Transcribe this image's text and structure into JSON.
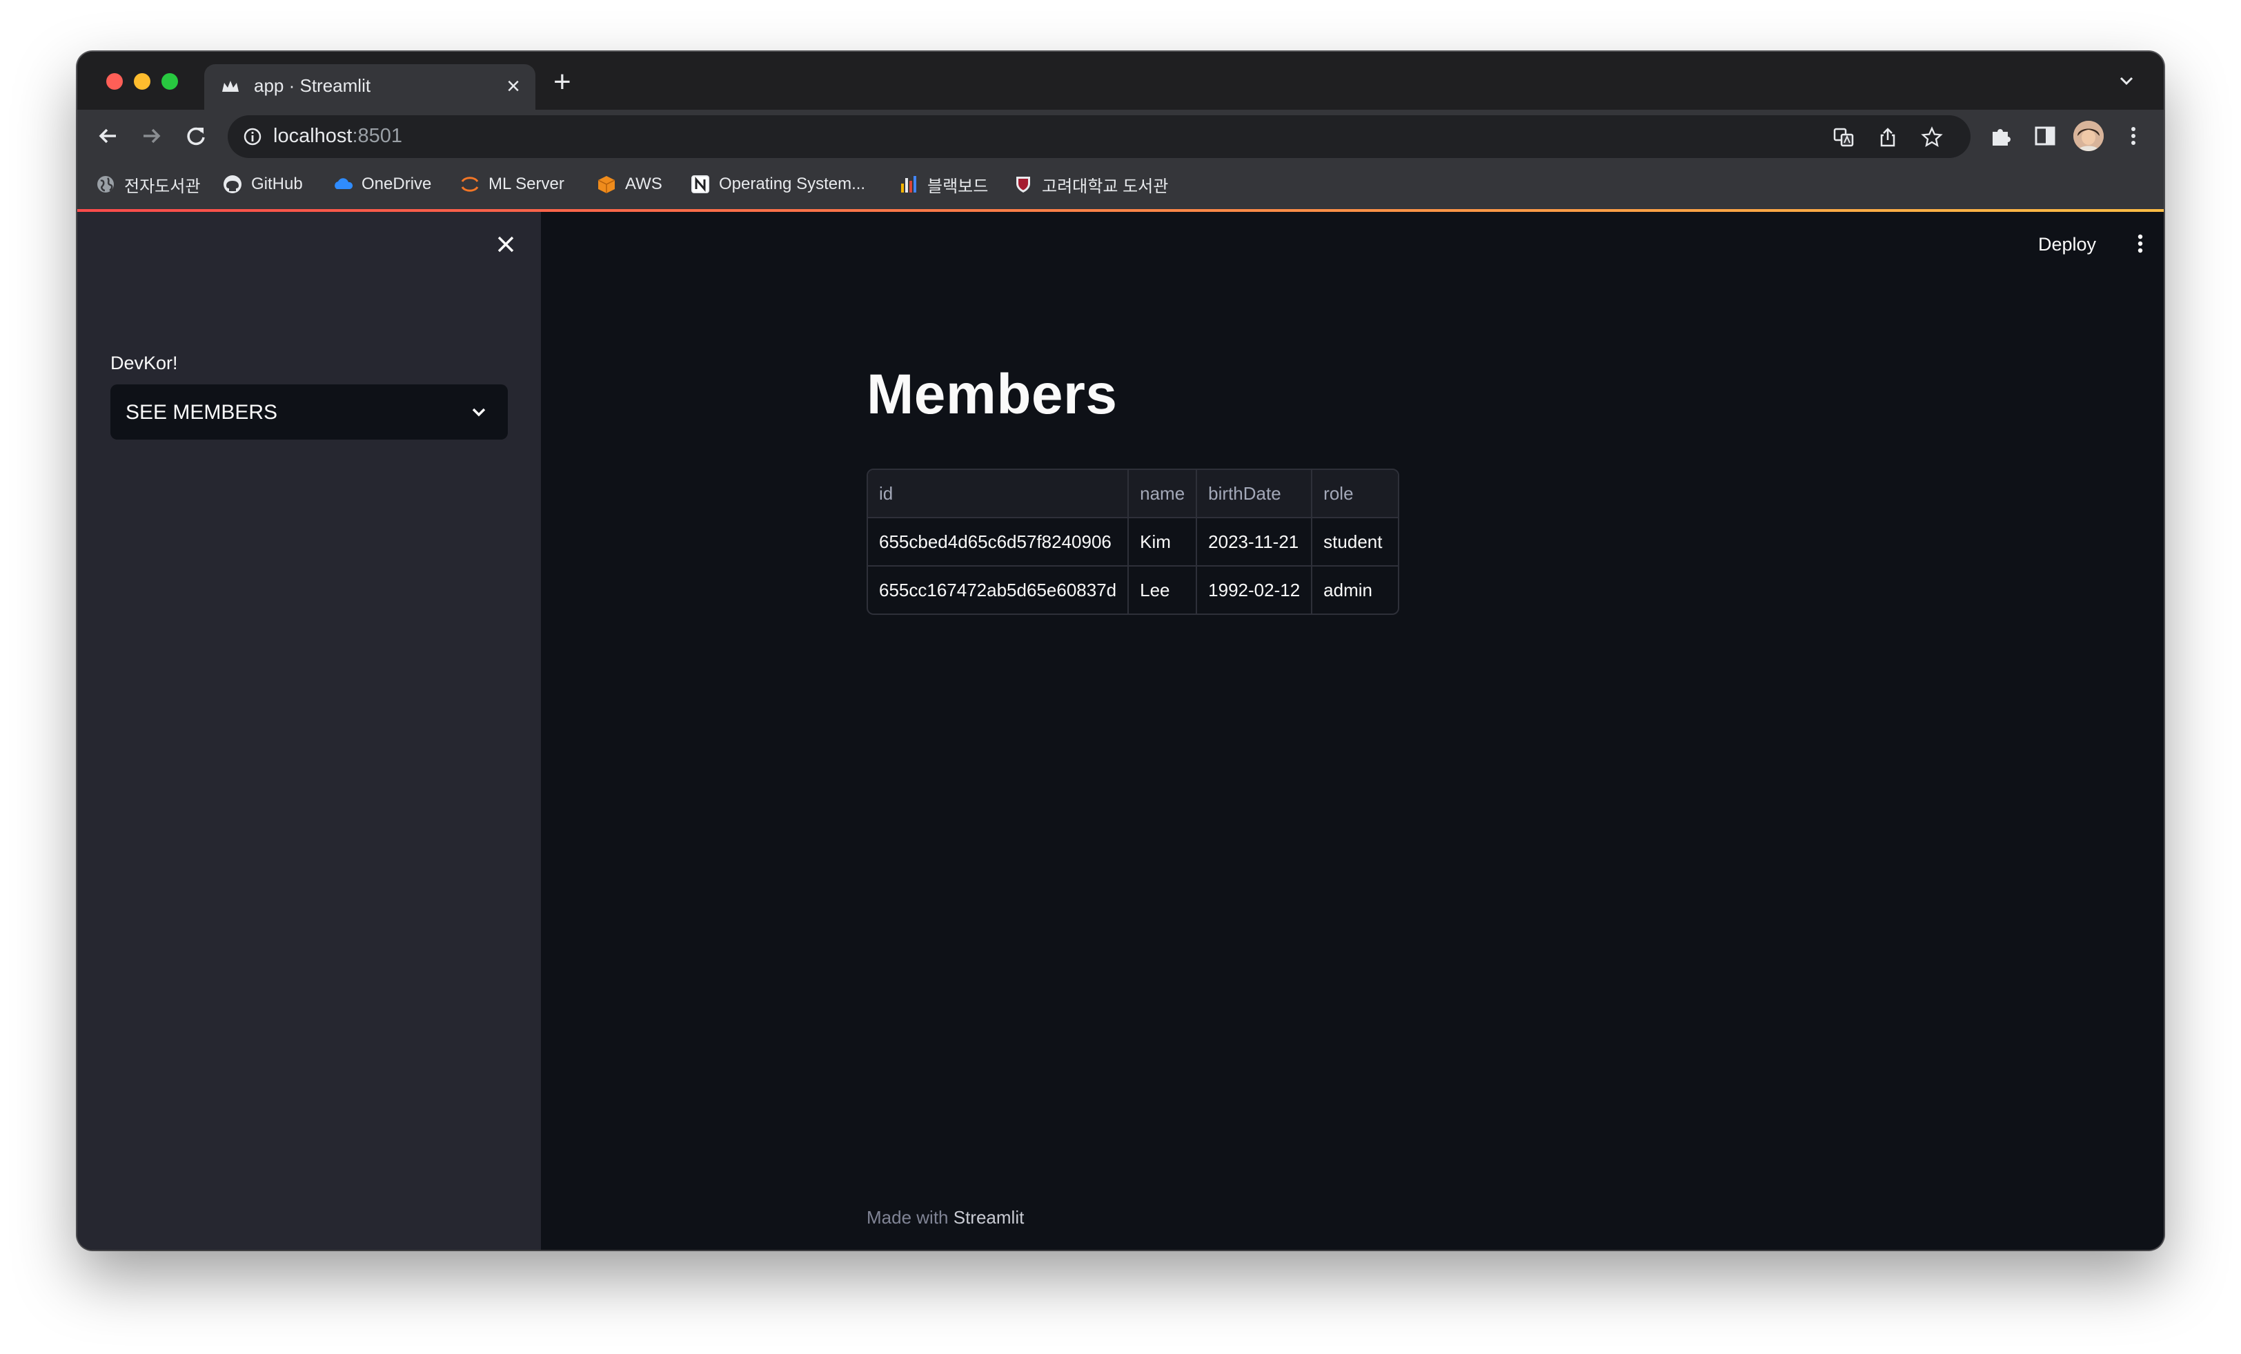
{
  "browser": {
    "tab_title": "app · Streamlit",
    "new_tab_label": "+",
    "tab_close_label": "×",
    "url_host": "localhost",
    "url_port": ":8501",
    "bookmarks": [
      {
        "label": "전자도서관",
        "icon": "globe-icon"
      },
      {
        "label": "GitHub",
        "icon": "github-icon"
      },
      {
        "label": "OneDrive",
        "icon": "cloud-icon"
      },
      {
        "label": "ML Server",
        "icon": "jupyter-icon"
      },
      {
        "label": "AWS",
        "icon": "box-icon"
      },
      {
        "label": "Operating System...",
        "icon": "notion-icon"
      },
      {
        "label": "블랙보드",
        "icon": "bars-icon"
      },
      {
        "label": "고려대학교 도서관",
        "icon": "crest-icon"
      }
    ]
  },
  "sidebar": {
    "label": "DevKor!",
    "select_value": "SEE MEMBERS"
  },
  "header": {
    "deploy_label": "Deploy"
  },
  "main": {
    "title": "Members",
    "table": {
      "columns": [
        "id",
        "name",
        "birthDate",
        "role"
      ],
      "rows": [
        [
          "655cbed4d65c6d57f8240906",
          "Kim",
          "2023-11-21",
          "student"
        ],
        [
          "655cc167472ab5d65e60837d",
          "Lee",
          "1992-02-12",
          "admin"
        ]
      ]
    }
  },
  "footer": {
    "prefix": "Made with",
    "brand": "Streamlit"
  },
  "colors": {
    "app_bg": "#0e1117",
    "sidebar_bg": "#262730",
    "accent_start": "#ff4b4b",
    "accent_end": "#ffbd45"
  }
}
